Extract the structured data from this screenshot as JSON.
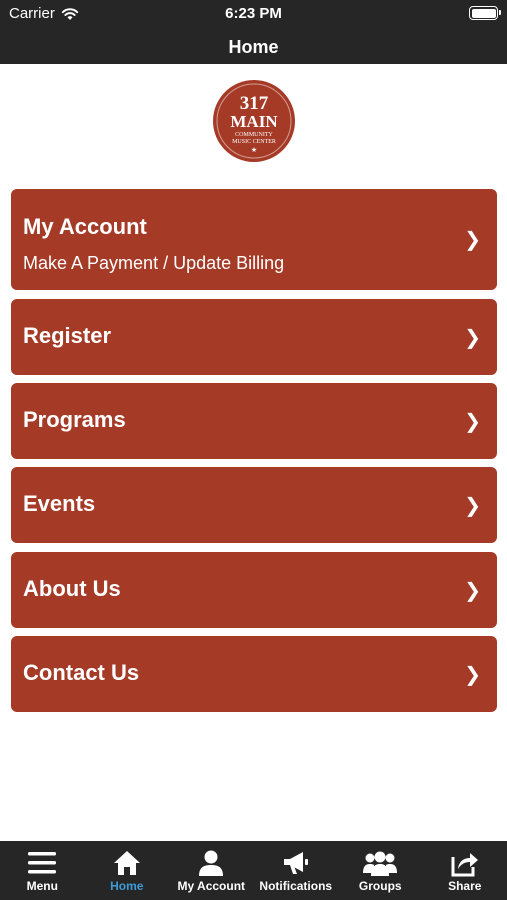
{
  "status_bar": {
    "carrier": "Carrier",
    "time": "6:23 PM",
    "wifi_icon": "wifi-icon",
    "battery_icon": "battery-icon"
  },
  "nav": {
    "title": "Home"
  },
  "logo": {
    "number": "317",
    "word": "MAIN",
    "line1": "COMMUNITY",
    "line2": "MUSIC CENTER",
    "color": "#a53a27"
  },
  "menu": {
    "items": [
      {
        "label": "My Account",
        "sublabel": "Make A Payment / Update Billing",
        "chevron": "❯"
      },
      {
        "label": "Register",
        "chevron": "❯"
      },
      {
        "label": "Programs",
        "chevron": "❯"
      },
      {
        "label": "Events",
        "chevron": "❯"
      },
      {
        "label": "About Us",
        "chevron": "❯"
      },
      {
        "label": "Contact Us",
        "chevron": "❯"
      }
    ]
  },
  "tabs": [
    {
      "label": "Menu",
      "icon": "hamburger-icon"
    },
    {
      "label": "Home",
      "icon": "home-icon",
      "active": true
    },
    {
      "label": "My Account",
      "icon": "user-icon"
    },
    {
      "label": "Notifications",
      "icon": "megaphone-icon"
    },
    {
      "label": "Groups",
      "icon": "group-icon"
    },
    {
      "label": "Share",
      "icon": "share-icon"
    }
  ],
  "colors": {
    "brand": "#a53a27",
    "bar": "#262626",
    "active_tab": "#3d9bd6"
  }
}
